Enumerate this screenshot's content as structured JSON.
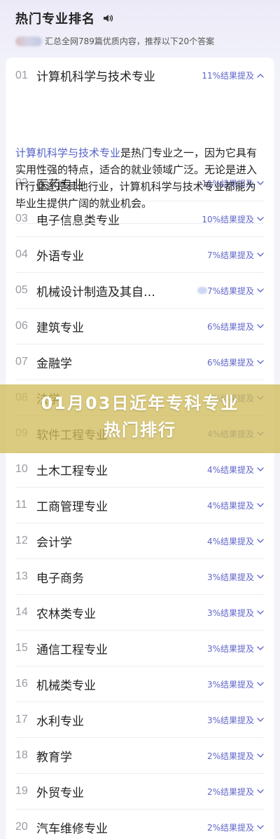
{
  "header": {
    "title": "热门专业排名",
    "subtitle": "汇总全网789篇优质内容，推荐以下20个答案"
  },
  "expanded": {
    "highlight": "计算机科学与技术专业",
    "text": "是热门专业之一，因为它具有实用性强的特点，适合的就业领域广泛。无论是进入IT行业还是其他行业，计算机科学与技术专业都能为毕业生提供广阔的就业机会。"
  },
  "banner": {
    "line1": "01月03日近年专科专业",
    "line2": "热门排行"
  },
  "items": [
    {
      "num": "01",
      "name": "计算机科学与技术专业",
      "pct": "11%结果提及"
    },
    {
      "num": "02",
      "name": "医药专业",
      "pct": "11%结果提及"
    },
    {
      "num": "03",
      "name": "电子信息类专业",
      "pct": "10%结果提及"
    },
    {
      "num": "04",
      "name": "外语专业",
      "pct": "7%结果提及"
    },
    {
      "num": "05",
      "name": "机械设计制造及其自…",
      "pct": "7%结果提及"
    },
    {
      "num": "06",
      "name": "建筑专业",
      "pct": "6%结果提及"
    },
    {
      "num": "07",
      "name": "金融学",
      "pct": "6%结果提及"
    },
    {
      "num": "08",
      "name": "法学",
      "pct": "5%结果提及"
    },
    {
      "num": "09",
      "name": "软件工程专业",
      "pct": "4%结果提及"
    },
    {
      "num": "10",
      "name": "土木工程专业",
      "pct": "4%结果提及"
    },
    {
      "num": "11",
      "name": "工商管理专业",
      "pct": "4%结果提及"
    },
    {
      "num": "12",
      "name": "会计学",
      "pct": "4%结果提及"
    },
    {
      "num": "13",
      "name": "电子商务",
      "pct": "3%结果提及"
    },
    {
      "num": "14",
      "name": "农林类专业",
      "pct": "3%结果提及"
    },
    {
      "num": "15",
      "name": "通信工程专业",
      "pct": "3%结果提及"
    },
    {
      "num": "16",
      "name": "机械类专业",
      "pct": "3%结果提及"
    },
    {
      "num": "17",
      "name": "水利专业",
      "pct": "3%结果提及"
    },
    {
      "num": "18",
      "name": "教育学",
      "pct": "2%结果提及"
    },
    {
      "num": "19",
      "name": "外贸专业",
      "pct": "2%结果提及"
    },
    {
      "num": "20",
      "name": "汽车维修专业",
      "pct": "2%结果提及"
    }
  ]
}
